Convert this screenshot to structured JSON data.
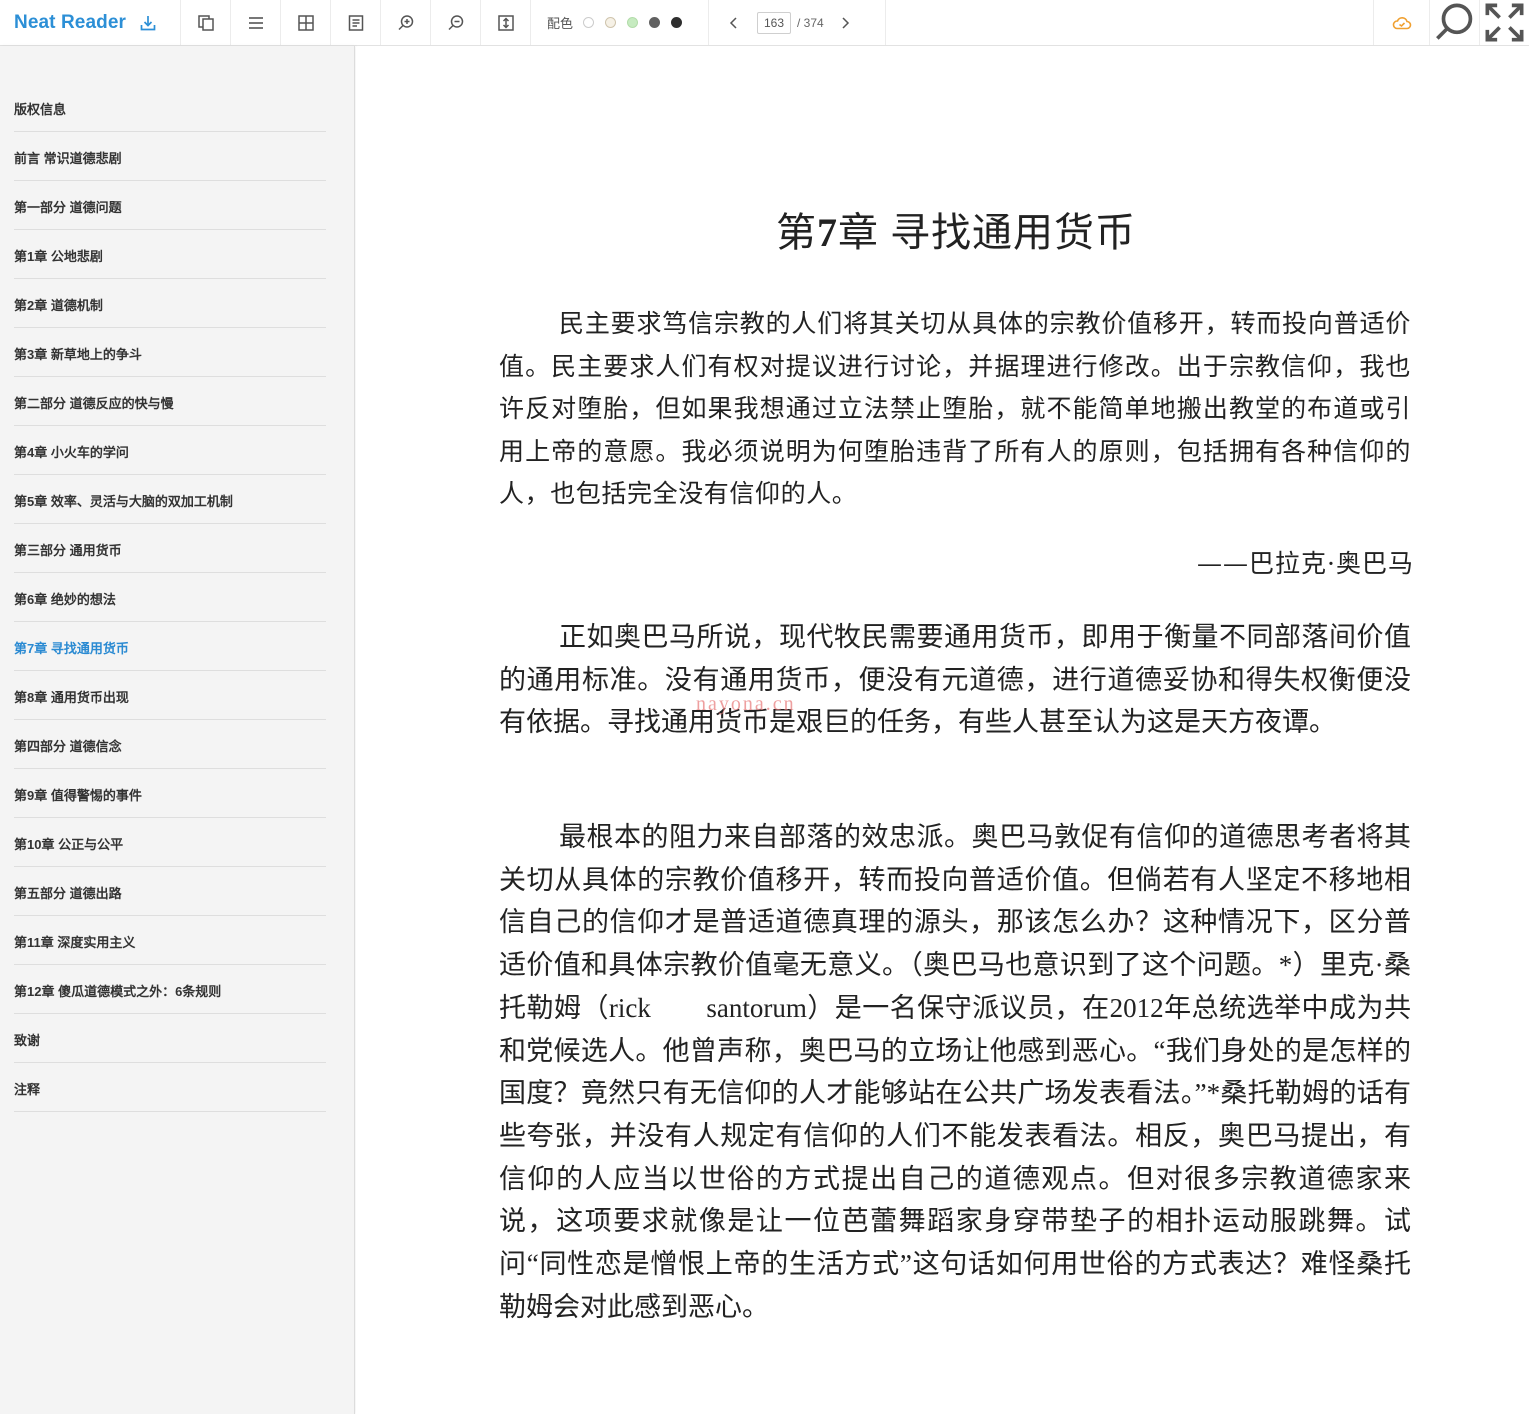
{
  "app": {
    "name": "Neat Reader"
  },
  "toolbar": {
    "color_scheme_label": "配色",
    "swatches": [
      {
        "fill": "#ffffff",
        "border": "#cccccc"
      },
      {
        "fill": "#f6f1e6",
        "border": "#cfc4ad"
      },
      {
        "fill": "#c6ebc0",
        "border": "#b2dca9"
      },
      {
        "fill": "#616161",
        "border": "#616161"
      },
      {
        "fill": "#2f2f2f",
        "border": "#2f2f2f"
      }
    ],
    "current_page": "163",
    "total_pages": "/ 374"
  },
  "toc": {
    "active_index": 11,
    "items": [
      "版权信息",
      "前言 常识道德悲剧",
      "第一部分 道德问题",
      "第1章 公地悲剧",
      "第2章 道德机制",
      "第3章 新草地上的争斗",
      "第二部分 道德反应的快与慢",
      "第4章 小火车的学问",
      "第5章 效率、灵活与大脑的双加工机制",
      "第三部分 通用货币",
      "第6章 绝妙的想法",
      "第7章 寻找通用货币",
      "第8章 通用货币出现",
      "第四部分 道德信念",
      "第9章 值得警惕的事件",
      "第10章 公正与公平",
      "第五部分 道德出路",
      "第11章 深度实用主义",
      "第12章 傻瓜道德模式之外：6条规则",
      "致谢",
      "注释"
    ]
  },
  "content": {
    "title_prefix": "第",
    "title_number": "7",
    "title_suffix": "章 寻找通用货币",
    "epigraph": "民主要求笃信宗教的人们将其关切从具体的宗教价值移开，转而投向普适价值。民主要求人们有权对提议进行讨论，并据理进行修改。出于宗教信仰，我也许反对堕胎，但如果我想通过立法禁止堕胎，就不能简单地搬出教堂的布道或引用上帝的意愿。我必须说明为何堕胎违背了所有人的原则，包括拥有各种信仰的人，也包括完全没有信仰的人。",
    "attribution": "——巴拉克·奥巴马",
    "paragraph1": "正如奥巴马所说，现代牧民需要通用货币，即用于衡量不同部落间价值的通用标准。没有通用货币，便没有元道德，进行道德妥协和得失权衡便没有依据。寻找通用货币是艰巨的任务，有些人甚至认为这是天方夜谭。",
    "paragraph2": "最根本的阻力来自部落的效忠派。奥巴马敦促有信仰的道德思考者将其关切从具体的宗教价值移开，转而投向普适价值。但倘若有人坚定不移地相信自己的信仰才是普适道德真理的源头，那该怎么办？这种情况下，区分普适价值和具体宗教价值毫无意义。（奥巴马也意识到了这个问题。*）里克·桑托勒姆（rick　　santorum）是一名保守派议员，在2012年总统选举中成为共和党候选人。他曾声称，奥巴马的立场让他感到恶心。“我们身处的是怎样的国度？竟然只有无信仰的人才能够站在公共广场发表看法。”*桑托勒姆的话有些夸张，并没有人规定有信仰的人们不能发表看法。相反，奥巴马提出，有信仰的人应当以世俗的方式提出自己的道德观点。但对很多宗教道德家来说，这项要求就像是让一位芭蕾舞蹈家身穿带垫子的相扑运动服跳舞。试问“同性恋是憎恨上帝的生活方式”这句话如何用世俗的方式表达？难怪桑托勒姆会对此感到恶心。",
    "watermark": "nayona.cn"
  },
  "colors": {
    "brand": "#2c8fd6",
    "active_toc": "#2a8ad2",
    "cloud_icon": "#f0a030",
    "icon": "#555555"
  }
}
